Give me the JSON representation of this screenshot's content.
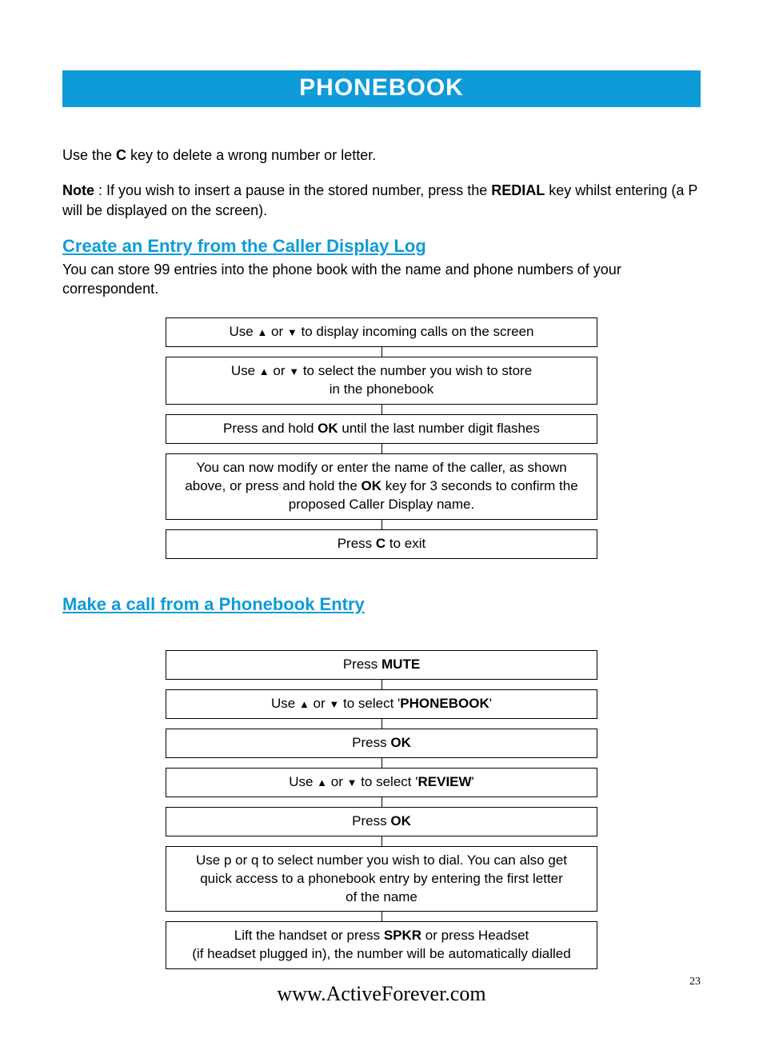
{
  "title": "PHONEBOOK",
  "intro": {
    "use_the": "Use the ",
    "c_key": "C",
    "after_c": " key to delete a wrong number or letter."
  },
  "note": {
    "label": "Note",
    "before_redial": " : If you wish to insert a pause in the stored number, press the ",
    "redial": "REDIAL",
    "after_redial": " key whilst entering (a P will be displayed on the screen)."
  },
  "section1": {
    "heading": "Create an Entry from the Caller Display Log",
    "desc": "You can store 99 entries into the phone book with the name and phone numbers of your correspondent.",
    "steps": {
      "s1_pre": "Use ",
      "s1_post": " to display incoming calls on the screen",
      "s2_pre": "Use ",
      "s2_post": "  to select the number you wish to store",
      "s2_line2": "in the phonebook",
      "s3_pre": "Press and hold ",
      "s3_ok": "OK",
      "s3_post": " until the last number digit ﬂashes",
      "s4_line1": "You can now modify or enter the name of the caller, as shown",
      "s4_pre2": "above, or press and hold the ",
      "s4_ok": "OK",
      "s4_post2": " key for 3 seconds to conﬁrm the",
      "s4_line3": "proposed Caller Display name.",
      "s5_pre": "Press ",
      "s5_c": "C",
      "s5_post": " to exit"
    }
  },
  "section2": {
    "heading": "Make a call from a Phonebook Entry",
    "steps": {
      "s1_pre": "Press ",
      "s1_mute": "MUTE",
      "s2_pre": "Use  ",
      "s2_mid": " to select '",
      "s2_pb": "PHONEBOOK",
      "s2_post": "'",
      "s3_pre": "Press ",
      "s3_ok": "OK",
      "s4_pre": "Use ",
      "s4_mid": " to select '",
      "s4_rev": "REVIEW",
      "s4_post": "'",
      "s5_pre": "Press ",
      "s5_ok": "OK",
      "s6_l1": "Use p or q to select number you wish to dial. You can also get",
      "s6_l2": "quick access to a phonebook entry by entering the ﬁrst letter",
      "s6_l3": "of the name",
      "s7_pre": "Lift the handset or press ",
      "s7_spkr": "SPKR",
      "s7_post": " or press Headset",
      "s7_l2": "(if headset plugged in), the number will be automatically dialled"
    }
  },
  "footer_url": "www.ActiveForever.com",
  "page_number": "23",
  "glyphs": {
    "up": "▲",
    "down": "▼",
    "or": " or "
  }
}
